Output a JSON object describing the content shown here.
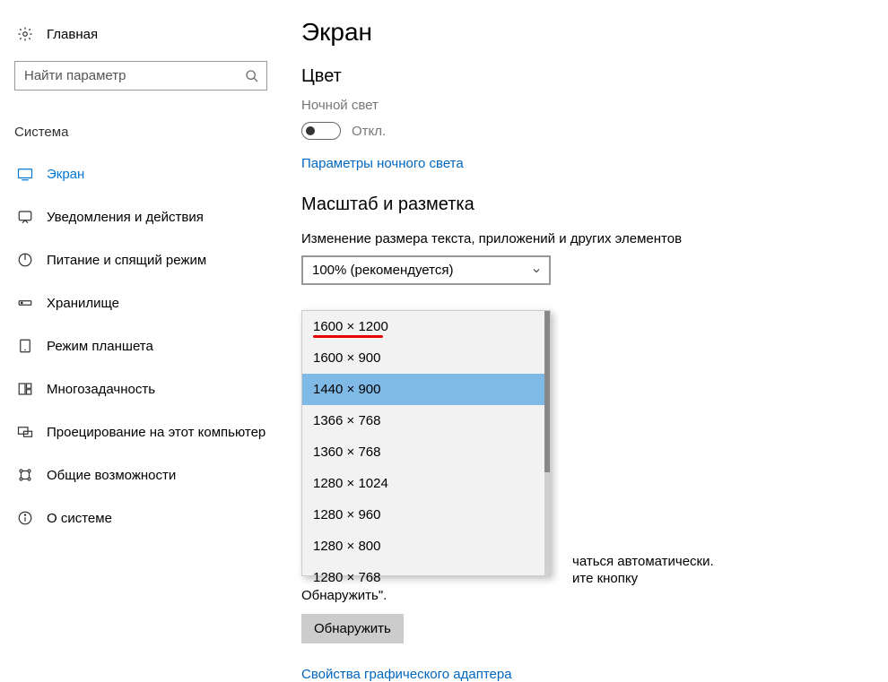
{
  "sidebar": {
    "home_label": "Главная",
    "search_placeholder": "Найти параметр",
    "category": "Система",
    "items": [
      {
        "label": "Экран",
        "icon": "display-icon",
        "active": true
      },
      {
        "label": "Уведомления и действия",
        "icon": "notification-icon"
      },
      {
        "label": "Питание и спящий режим",
        "icon": "power-icon"
      },
      {
        "label": "Хранилище",
        "icon": "storage-icon"
      },
      {
        "label": "Режим планшета",
        "icon": "tablet-mode-icon"
      },
      {
        "label": "Многозадачность",
        "icon": "multitask-icon"
      },
      {
        "label": "Проецирование на этот компьютер",
        "icon": "project-icon"
      },
      {
        "label": "Общие возможности",
        "icon": "shared-icon"
      },
      {
        "label": "О системе",
        "icon": "about-icon"
      }
    ]
  },
  "main": {
    "title": "Экран",
    "color_section": "Цвет",
    "night_light_label": "Ночной свет",
    "night_light_state": "Откл.",
    "night_light_link": "Параметры ночного света",
    "scale_section": "Масштаб и разметка",
    "scale_label": "Изменение размера текста, приложений и других элементов",
    "scale_value": "100% (рекомендуется)",
    "resolution_dropdown": {
      "options": [
        "1600 × 1200",
        "1600 × 900",
        "1440 × 900",
        "1366 × 768",
        "1360 × 768",
        "1280 × 1024",
        "1280 × 960",
        "1280 × 800",
        "1280 × 768"
      ],
      "selected_index": 2
    },
    "overflow_text_1": "чаться автоматически.",
    "overflow_text_2": "ите кнопку",
    "orphan_text": "Обнаружить\".",
    "detect_button": "Обнаружить",
    "adapter_link": "Свойства графического адаптера"
  }
}
